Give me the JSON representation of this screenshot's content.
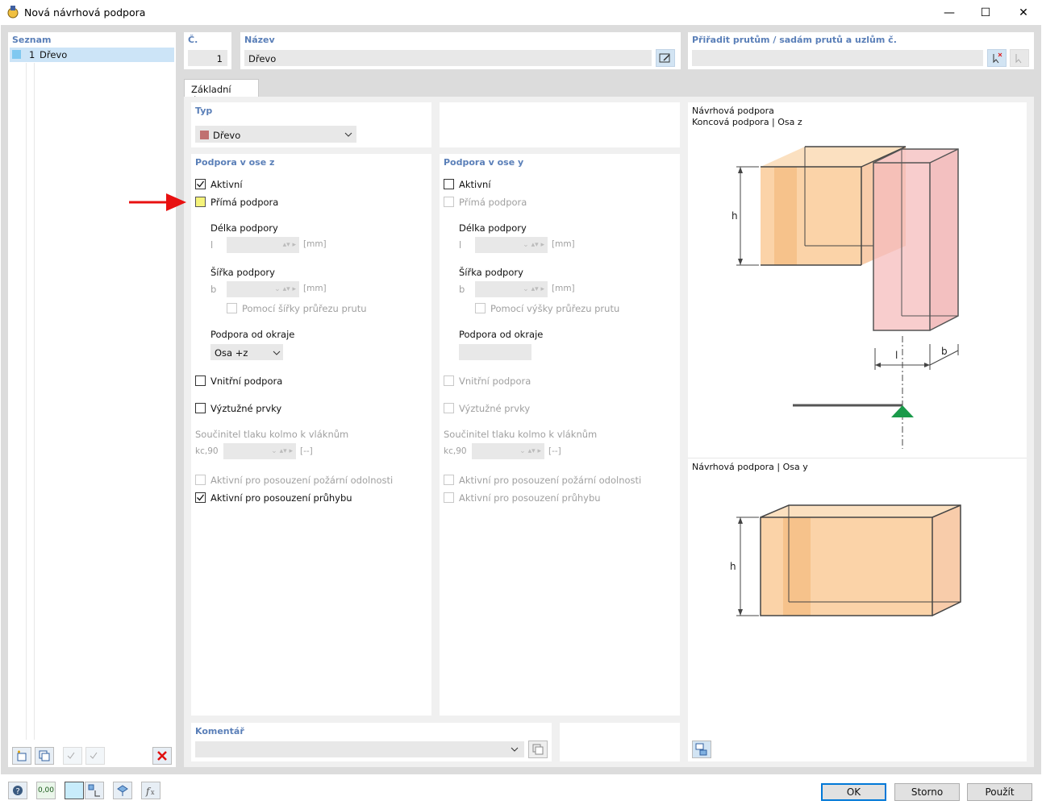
{
  "window": {
    "title": "Nová návrhová podpora",
    "minimize": "—",
    "maximize": "☐",
    "close": "✕"
  },
  "list": {
    "header": "Seznam",
    "items": [
      {
        "number": "1",
        "name": "Dřevo",
        "color": "#7fc8f0"
      }
    ]
  },
  "no": {
    "label": "Č.",
    "value": "1"
  },
  "name": {
    "label": "Název",
    "value": "Dřevo"
  },
  "assign": {
    "label": "Přiřadit prutům / sadám prutů a uzlům č.",
    "value": ""
  },
  "tabs": [
    {
      "label": "Základní údaje"
    }
  ],
  "type": {
    "header": "Typ",
    "value": "Dřevo",
    "swatch": "#c07070"
  },
  "support_z": {
    "header": "Podpora v ose z",
    "active": "Aktivní",
    "direct": "Přímá podpora",
    "length_label": "Délka podpory",
    "length_symbol": "l",
    "length_unit": "[mm]",
    "width_label": "Šířka podpory",
    "width_symbol": "b",
    "width_unit": "[mm]",
    "width_by_section": "Pomocí šířky průřezu prutu",
    "edge_label": "Podpora od okraje",
    "edge_value": "Osa +z",
    "inner": "Vnitřní podpora",
    "stiffeners": "Výztužné prvky",
    "coef_label": "Součinitel tlaku kolmo k vláknům",
    "coef_symbol": "kc,90",
    "coef_unit": "[--]",
    "fire": "Aktivní pro posouzení požární odolnosti",
    "deflection": "Aktivní pro posouzení průhybu"
  },
  "support_y": {
    "header": "Podpora v ose y",
    "active": "Aktivní",
    "direct": "Přímá podpora",
    "length_label": "Délka podpory",
    "length_symbol": "l",
    "length_unit": "[mm]",
    "width_label": "Šířka podpory",
    "width_symbol": "b",
    "width_unit": "[mm]",
    "height_by_section": "Pomocí výšky průřezu prutu",
    "edge_label": "Podpora od okraje",
    "inner": "Vnitřní podpora",
    "stiffeners": "Výztužné prvky",
    "coef_label": "Součinitel tlaku kolmo k vláknům",
    "coef_symbol": "kc,90",
    "coef_unit": "[--]",
    "fire": "Aktivní pro posouzení požární odolnosti",
    "deflection": "Aktivní pro posouzení průhybu"
  },
  "comment": {
    "header": "Komentář",
    "value": ""
  },
  "preview": {
    "title1": "Návrhová podpora",
    "subtitle1": "Koncová podpora | Osa z",
    "title2": "Návrhová podpora | Osa y",
    "dim_h": "h",
    "dim_l": "l",
    "dim_b": "b"
  },
  "buttons": {
    "ok": "OK",
    "cancel": "Storno",
    "apply": "Použít"
  },
  "bottom_value": "0,00",
  "colors": {
    "accent": "#5a7fb8",
    "arrow": "#e81010",
    "support": "#1a9a4a"
  }
}
